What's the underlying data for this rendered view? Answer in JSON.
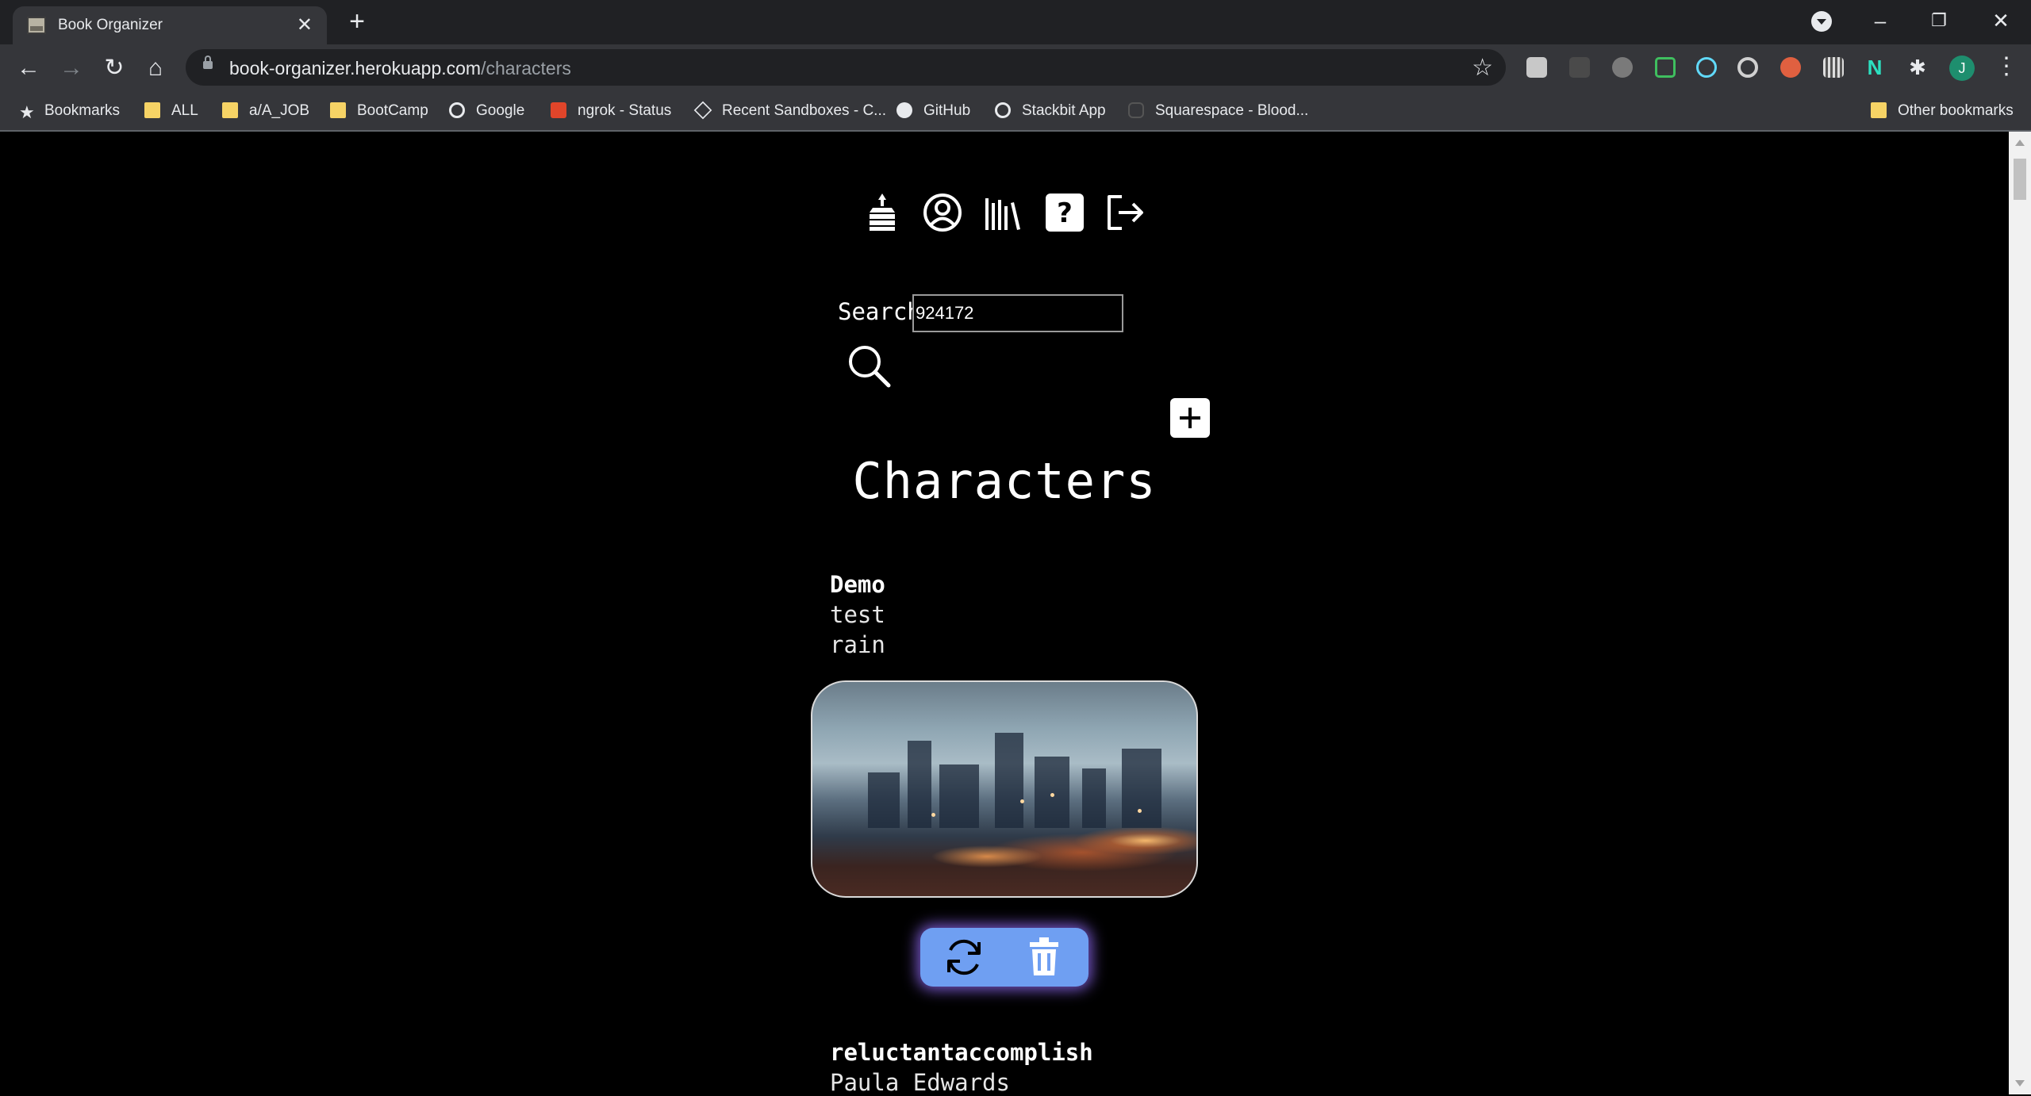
{
  "browser": {
    "tab_title": "Book Organizer",
    "url_host": "book-organizer.herokuapp.com",
    "url_path": "/characters",
    "avatar_initial": "J",
    "bookmarks": [
      "Bookmarks",
      "ALL",
      "a/A_JOB",
      "BootCamp",
      "Google",
      "ngrok - Status",
      "Recent Sandboxes - C...",
      "GitHub",
      "Stackbit App",
      "Squarespace - Blood..."
    ],
    "other_bookmarks": "Other bookmarks"
  },
  "nav": {
    "icons": [
      "books-stack-icon",
      "user-circle-icon",
      "library-icon",
      "help-icon",
      "logout-icon"
    ]
  },
  "search": {
    "label": "Search",
    "value": "924172"
  },
  "page": {
    "title": "Characters"
  },
  "characters": [
    {
      "name": "Demo",
      "line1": "test",
      "line2": "rain"
    },
    {
      "name": "reluctantaccomplish",
      "line1": "Paula Edwards"
    }
  ],
  "colors": {
    "background": "#000000",
    "action_bar": "#6f9ff2",
    "action_glow": "#9a6eff"
  }
}
